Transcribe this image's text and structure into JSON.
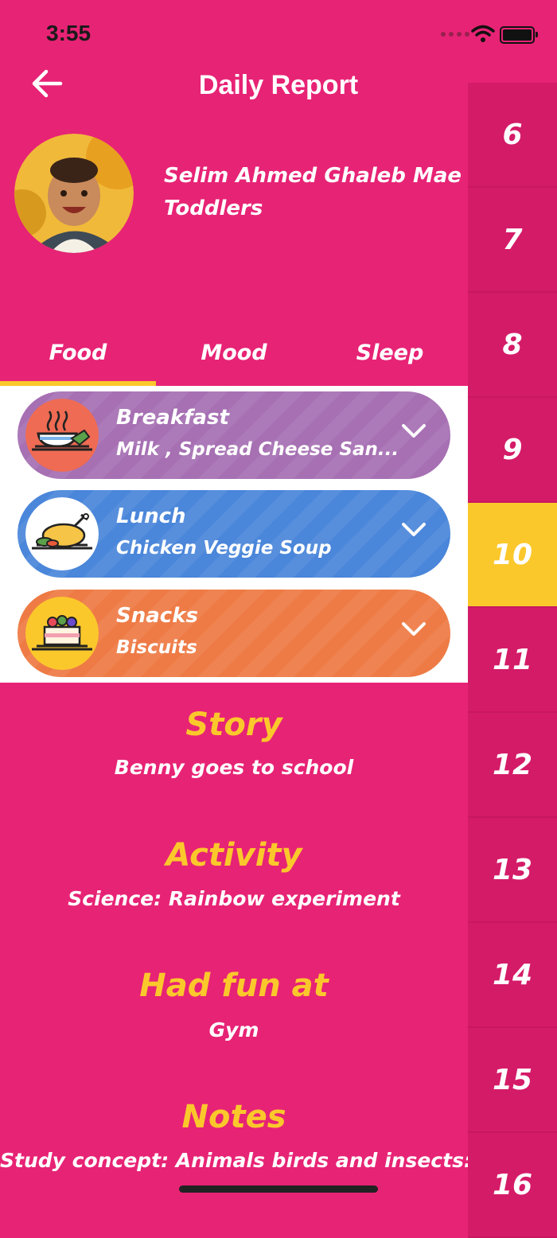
{
  "status_bar": {
    "time": "3:55"
  },
  "header": {
    "title": "Daily Report",
    "back_icon": "arrow-left-icon"
  },
  "child": {
    "name": "Selim Ahmed Ghaleb Mae",
    "group": "Toddlers"
  },
  "tabs": [
    {
      "label": "Food",
      "selected": true
    },
    {
      "label": "Mood",
      "selected": false
    },
    {
      "label": "Sleep",
      "selected": false
    }
  ],
  "meals": [
    {
      "title": "Breakfast",
      "desc": "Milk , Spread Cheese San...",
      "icon": "breakfast-bowl-icon",
      "color": "#A670B3",
      "icon_bg": "#EF6B53"
    },
    {
      "title": "Lunch",
      "desc": "Chicken Veggie Soup",
      "icon": "roast-chicken-icon",
      "color": "#4A86DA",
      "icon_bg": "#FFFFFF"
    },
    {
      "title": "Snacks",
      "desc": "Biscuits",
      "icon": "cake-icon",
      "color": "#EE7B45",
      "icon_bg": "#FBC82C"
    }
  ],
  "sections": [
    {
      "title": "Story",
      "value": "Benny goes to school"
    },
    {
      "title": "Activity",
      "value": "Science: Rainbow experiment"
    },
    {
      "title": "Had fun at",
      "value": "Gym"
    },
    {
      "title": "Notes",
      "value": "Study concept:  Animals birds and insects: During"
    }
  ],
  "days": [
    "6",
    "7",
    "8",
    "9",
    "10",
    "11",
    "12",
    "13",
    "14",
    "15",
    "16"
  ],
  "selected_day": "10",
  "colors": {
    "background": "#E72375",
    "day_strip": "#D41B68",
    "accent": "#FBC82C"
  }
}
